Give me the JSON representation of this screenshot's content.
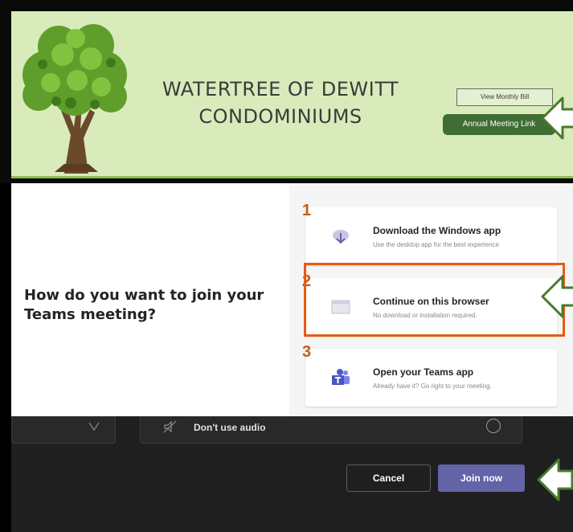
{
  "site_header": {
    "title_line1": "WATERTREE OF DEWITT",
    "title_line2": "CONDOMINIUMS",
    "view_bill_label": "View Monthly Bill",
    "meeting_link_label": "Annual Meeting Link",
    "logo_icon": "tree-icon"
  },
  "join_dialog": {
    "question": "How do you want to join your Teams meeting?",
    "options": [
      {
        "number": "1",
        "title": "Download the Windows app",
        "subtitle": "Use the desktop app for the best experience",
        "icon": "download-icon"
      },
      {
        "number": "2",
        "title": "Continue on this browser",
        "subtitle": "No download or installation required.",
        "icon": "browser-icon"
      },
      {
        "number": "3",
        "title": "Open your Teams app",
        "subtitle": "Already have it? Go right to your meeting.",
        "icon": "teams-icon"
      }
    ]
  },
  "teams_footer": {
    "audio_option_label": "Don't use audio",
    "cancel_label": "Cancel",
    "join_label": "Join now"
  },
  "colors": {
    "header_bg": "#d9ebbb",
    "meeting_button": "#3f6d33",
    "highlight": "#e55b13",
    "step_number": "#c55a1c",
    "join_button": "#6264a7",
    "arrow_outline": "#4a7a2c"
  }
}
